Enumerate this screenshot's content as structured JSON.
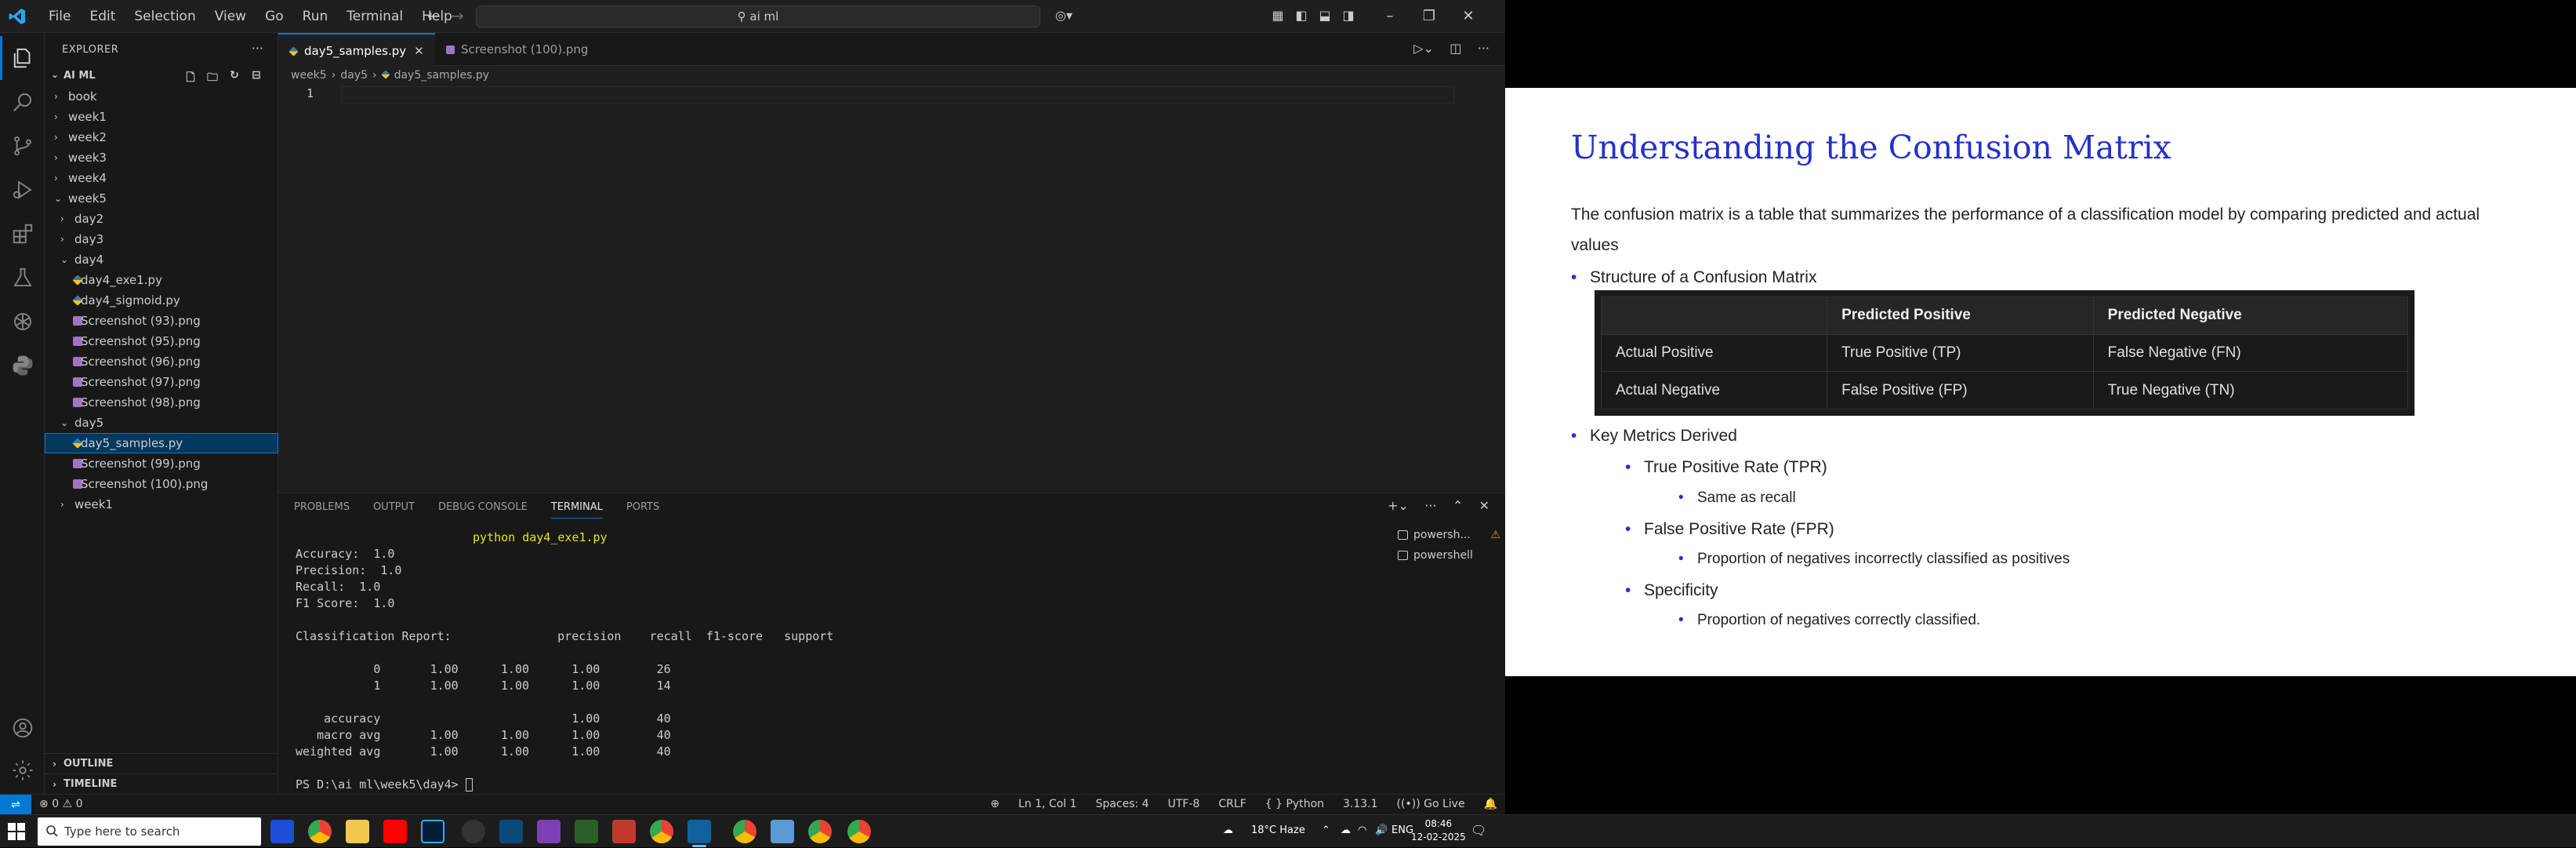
{
  "titlebar": {
    "menu": [
      "File",
      "Edit",
      "Selection",
      "View",
      "Go",
      "Run",
      "Terminal",
      "Help"
    ],
    "search": "ai ml"
  },
  "explorer": {
    "title": "EXPLORER",
    "root": "AI ML",
    "tree": [
      {
        "label": "book",
        "depth": 0,
        "kind": "folder",
        "open": false
      },
      {
        "label": "week1",
        "depth": 0,
        "kind": "folder",
        "open": false
      },
      {
        "label": "week2",
        "depth": 0,
        "kind": "folder",
        "open": false
      },
      {
        "label": "week3",
        "depth": 0,
        "kind": "folder",
        "open": false
      },
      {
        "label": "week4",
        "depth": 0,
        "kind": "folder",
        "open": false
      },
      {
        "label": "week5",
        "depth": 0,
        "kind": "folder",
        "open": true
      },
      {
        "label": "day2",
        "depth": 1,
        "kind": "folder",
        "open": false
      },
      {
        "label": "day3",
        "depth": 1,
        "kind": "folder",
        "open": false
      },
      {
        "label": "day4",
        "depth": 1,
        "kind": "folder",
        "open": true
      },
      {
        "label": "day4_exe1.py",
        "depth": 2,
        "kind": "py"
      },
      {
        "label": "day4_sigmoid.py",
        "depth": 2,
        "kind": "py"
      },
      {
        "label": "Screenshot (93).png",
        "depth": 2,
        "kind": "png"
      },
      {
        "label": "Screenshot (95).png",
        "depth": 2,
        "kind": "png"
      },
      {
        "label": "Screenshot (96).png",
        "depth": 2,
        "kind": "png"
      },
      {
        "label": "Screenshot (97).png",
        "depth": 2,
        "kind": "png"
      },
      {
        "label": "Screenshot (98).png",
        "depth": 2,
        "kind": "png"
      },
      {
        "label": "day5",
        "depth": 1,
        "kind": "folder",
        "open": true
      },
      {
        "label": "day5_samples.py",
        "depth": 2,
        "kind": "py",
        "selected": true
      },
      {
        "label": "Screenshot (99).png",
        "depth": 2,
        "kind": "png"
      },
      {
        "label": "Screenshot (100).png",
        "depth": 2,
        "kind": "png"
      },
      {
        "label": "week1",
        "depth": 1,
        "kind": "folder",
        "open": false
      }
    ],
    "outline": "OUTLINE",
    "timeline": "TIMELINE"
  },
  "editor": {
    "tabs": [
      {
        "label": "day5_samples.py",
        "active": true
      },
      {
        "label": "Screenshot (100).png",
        "active": false
      }
    ],
    "breadcrumb": [
      "week5",
      "day5",
      "day5_samples.py"
    ],
    "line_number": "1"
  },
  "panel": {
    "tabs": [
      "PROBLEMS",
      "OUTPUT",
      "DEBUG CONSOLE",
      "TERMINAL",
      "PORTS"
    ],
    "active_tab": "TERMINAL",
    "command": "python day4_exe1.py",
    "terminal_lines": [
      "Accuracy:  1.0",
      "Precision:  1.0",
      "Recall:  1.0",
      "F1 Score:  1.0",
      "",
      "Classification Report:               precision    recall  f1-score   support",
      "",
      "           0       1.00      1.00      1.00        26",
      "           1       1.00      1.00      1.00        14",
      "",
      "    accuracy                           1.00        40",
      "   macro avg       1.00      1.00      1.00        40",
      "weighted avg       1.00      1.00      1.00        40",
      "",
      "PS D:\\ai ml\\week5\\day4> "
    ],
    "terminals": [
      "powersh...",
      "powershell"
    ]
  },
  "statusbar": {
    "errors": "0",
    "warnings": "0",
    "position": "Ln 1, Col 1",
    "spaces": "Spaces: 4",
    "encoding": "UTF-8",
    "eol": "CRLF",
    "language": "Python",
    "version": "3.13.1",
    "golive": "Go Live"
  },
  "slide": {
    "title": "Understanding the Confusion Matrix",
    "intro": "The confusion matrix is a table that summarizes the performance of a classification model by comparing predicted and actual values",
    "bullet1": "Structure of a Confusion Matrix",
    "table": {
      "headers": [
        "",
        "Predicted Positive",
        "Predicted Negative"
      ],
      "rows": [
        [
          "Actual Positive",
          "True Positive (TP)",
          "False Negative (FN)"
        ],
        [
          "Actual Negative",
          "False Positive (FP)",
          "True Negative (TN)"
        ]
      ]
    },
    "bullet2": "Key Metrics Derived",
    "metrics": [
      {
        "name": "True Positive Rate (TPR)",
        "detail": "Same as recall"
      },
      {
        "name": "False Positive Rate (FPR)",
        "detail": "Proportion of negatives incorrectly classified as positives"
      },
      {
        "name": "Specificity",
        "detail": "Proportion of negatives correctly classified."
      }
    ]
  },
  "taskbar": {
    "search_placeholder": "Type here to search",
    "weather": "18°C  Haze",
    "language": "ENG",
    "time": "08:46",
    "date": "12-02-2025"
  },
  "colors": {
    "accent": "#0078d4",
    "slide_title": "#2431c9",
    "terminal_command": "#e5e510"
  }
}
